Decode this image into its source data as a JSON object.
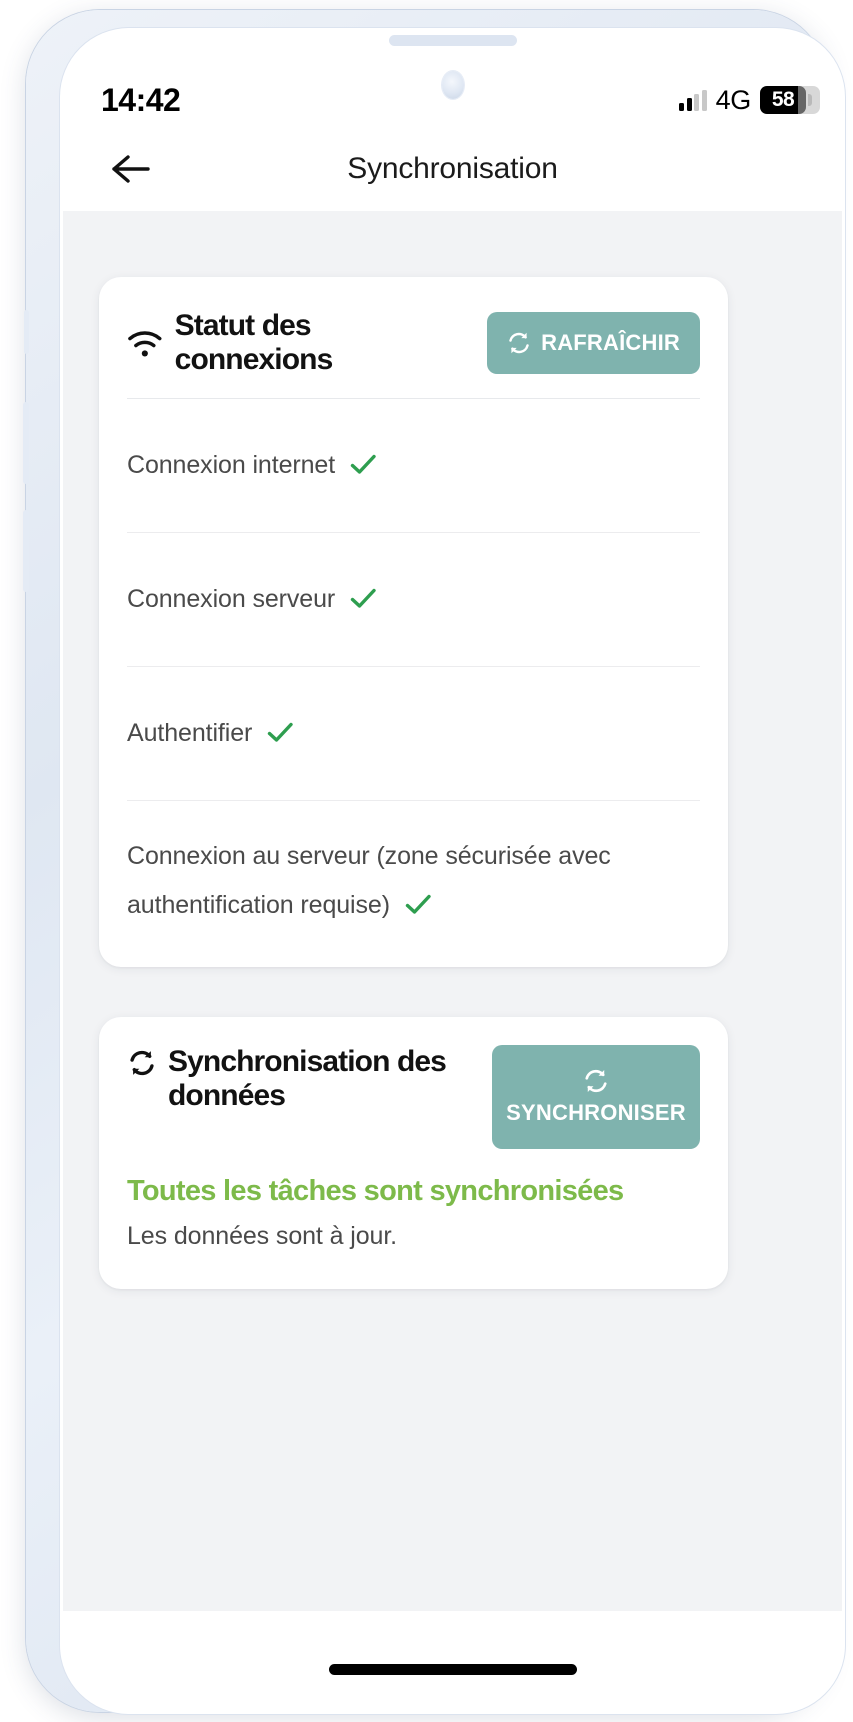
{
  "status_bar": {
    "time": "14:42",
    "network_type": "4G",
    "battery_level": "58",
    "signal_icon": "signal-bars-icon",
    "battery_icon": "battery-icon"
  },
  "app_bar": {
    "back_icon": "arrow-left-icon",
    "title": "Synchronisation"
  },
  "connections_card": {
    "icon": "wifi-icon",
    "title": "Statut des connexions",
    "refresh_button": {
      "icon": "refresh-icon",
      "label": "RAFRAÎCHIR"
    },
    "rows": [
      {
        "label": "Connexion internet",
        "status_icon": "check-icon",
        "status": "ok"
      },
      {
        "label": "Connexion serveur",
        "status_icon": "check-icon",
        "status": "ok"
      },
      {
        "label": "Authentifier",
        "status_icon": "check-icon",
        "status": "ok"
      },
      {
        "label": "Connexion au serveur (zone sécurisée avec authentification requise)",
        "status_icon": "check-icon",
        "status": "ok"
      }
    ]
  },
  "sync_card": {
    "icon": "refresh-icon",
    "title": "Synchronisation des données",
    "sync_button": {
      "icon": "refresh-icon",
      "label": "SYNCHRONISER"
    },
    "status_heading": "Toutes les tâches sont synchronisées",
    "status_detail": "Les données sont à jour."
  },
  "colors": {
    "teal_accent": "#7FB3AE",
    "success_green": "#7DBA4A",
    "check_green": "#2E9E4F",
    "page_background": "#F2F3F5",
    "card_background": "#FFFFFF",
    "body_text": "#4A4A4A",
    "heading_text": "#121212"
  }
}
